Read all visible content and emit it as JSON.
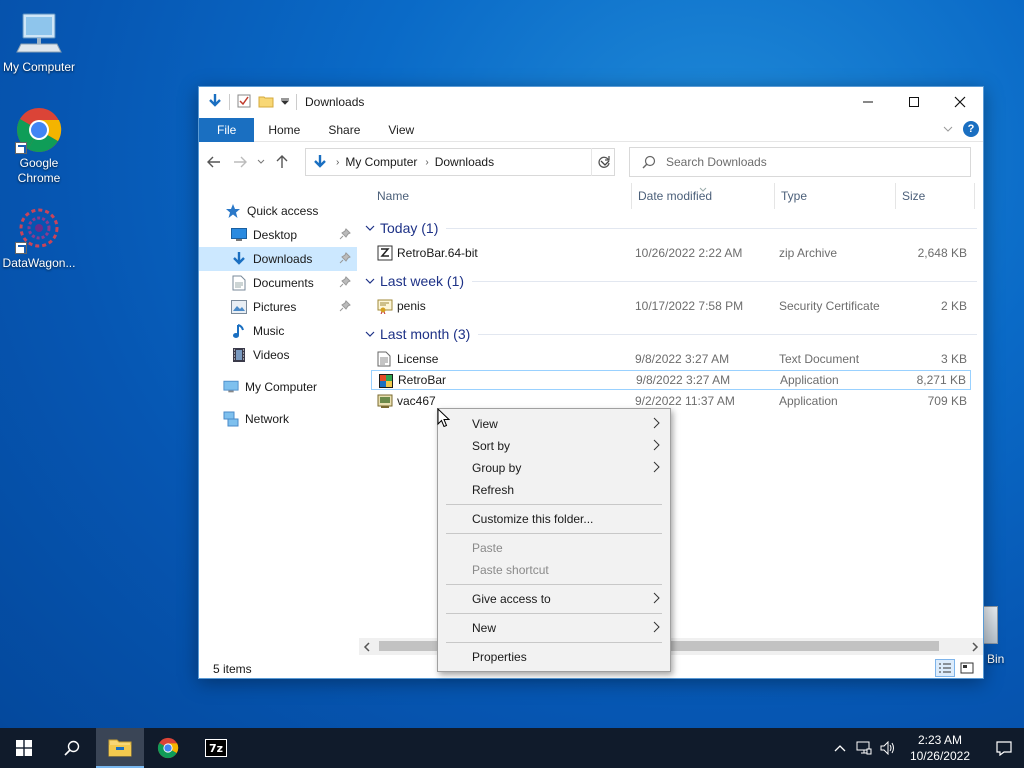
{
  "desktop": {
    "icons": [
      {
        "label": "My Computer"
      },
      {
        "label": "Google Chrome"
      },
      {
        "label": "DataWagon..."
      }
    ],
    "recycle_bin_label": "Bin"
  },
  "window": {
    "title": "Downloads",
    "ribbon_tabs": [
      "File",
      "Home",
      "Share",
      "View"
    ],
    "breadcrumb": [
      "My Computer",
      "Downloads"
    ],
    "search_placeholder": "Search Downloads",
    "columns": [
      "Name",
      "Date modified",
      "Type",
      "Size"
    ],
    "sidebar": [
      {
        "label": "Quick access",
        "icon": "star-icon"
      },
      {
        "label": "Desktop",
        "icon": "desktop-icon",
        "pinned": true
      },
      {
        "label": "Downloads",
        "icon": "download-icon",
        "pinned": true,
        "selected": true
      },
      {
        "label": "Documents",
        "icon": "documents-icon",
        "pinned": true
      },
      {
        "label": "Pictures",
        "icon": "pictures-icon",
        "pinned": true
      },
      {
        "label": "Music",
        "icon": "music-icon"
      },
      {
        "label": "Videos",
        "icon": "videos-icon"
      },
      {
        "label": "My Computer",
        "icon": "computer-icon"
      },
      {
        "label": "Network",
        "icon": "network-icon"
      }
    ],
    "groups": [
      {
        "label": "Today (1)",
        "files": [
          {
            "name": "RetroBar.64-bit",
            "date": "10/26/2022 2:22 AM",
            "type": "zip Archive",
            "size": "2,648 KB",
            "icon": "zip-icon"
          }
        ]
      },
      {
        "label": "Last week (1)",
        "files": [
          {
            "name": "penis",
            "date": "10/17/2022 7:58 PM",
            "type": "Security Certificate",
            "size": "2 KB",
            "icon": "certificate-icon"
          }
        ]
      },
      {
        "label": "Last month (3)",
        "files": [
          {
            "name": "License",
            "date": "9/8/2022 3:27 AM",
            "type": "Text Document",
            "size": "3 KB",
            "icon": "text-file-icon"
          },
          {
            "name": "RetroBar",
            "date": "9/8/2022 3:27 AM",
            "type": "Application",
            "size": "8,271 KB",
            "icon": "retrobar-app-icon",
            "selected": true
          },
          {
            "name": "vac467",
            "date": "9/2/2022 11:37 AM",
            "type": "Application",
            "size": "709 KB",
            "icon": "app-icon"
          }
        ]
      }
    ],
    "status": "5 items"
  },
  "context_menu": {
    "items": [
      {
        "label": "View",
        "submenu": true
      },
      {
        "label": "Sort by",
        "submenu": true
      },
      {
        "label": "Group by",
        "submenu": true
      },
      {
        "label": "Refresh"
      },
      {
        "label": "Customize this folder..."
      },
      {
        "label": "Paste",
        "disabled": true
      },
      {
        "label": "Paste shortcut",
        "disabled": true
      },
      {
        "label": "Give access to",
        "submenu": true
      },
      {
        "label": "New",
        "submenu": true
      },
      {
        "label": "Properties"
      }
    ]
  },
  "taskbar": {
    "time": "2:23 AM",
    "date": "10/26/2022"
  },
  "colors": {
    "accent": "#1a6fc1",
    "selection": "#cce8ff",
    "group_header": "#1e3287",
    "taskbar": "#101b2b"
  }
}
